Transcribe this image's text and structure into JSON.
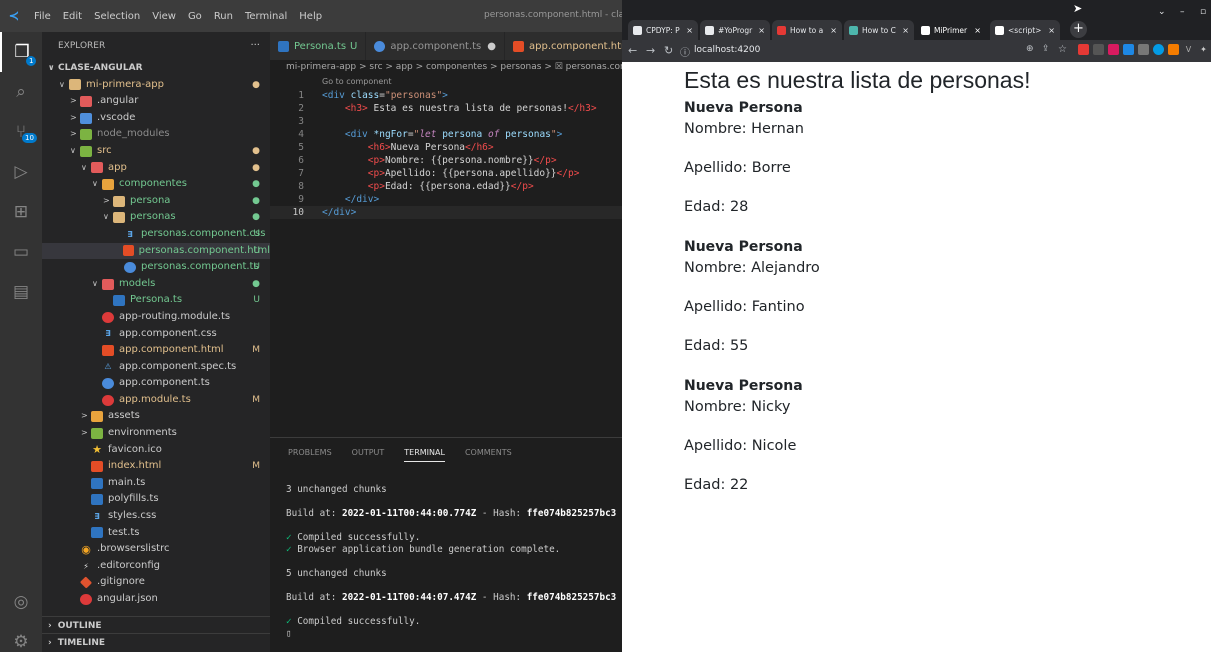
{
  "vscode": {
    "menu": [
      "File",
      "Edit",
      "Selection",
      "View",
      "Go",
      "Run",
      "Terminal",
      "Help"
    ],
    "window_title": "personas.component.html - clase-",
    "explorer_title": "EXPLORER",
    "explorer_more": "···",
    "tree": [
      {
        "label": "CLASE-ANGULAR",
        "arrow": "∨",
        "depth": 0,
        "icon": "",
        "status": "",
        "statusColor": "#ccc",
        "header": true,
        "color": "#cccccc"
      },
      {
        "label": "mi-primera-app",
        "arrow": "∨",
        "depth": 1,
        "icon": "folder",
        "status": "●",
        "statusColor": "#e2c08d",
        "color": "#e2c08d"
      },
      {
        "label": ".angular",
        "arrow": ">",
        "depth": 2,
        "icon": "folder-red",
        "status": "",
        "color": "#cccccc"
      },
      {
        "label": ".vscode",
        "arrow": ">",
        "depth": 2,
        "icon": "folder-blue",
        "status": "",
        "color": "#cccccc"
      },
      {
        "label": "node_modules",
        "arrow": ">",
        "depth": 2,
        "icon": "folder-green",
        "status": "",
        "color": "#8c8c8c"
      },
      {
        "label": "src",
        "arrow": "∨",
        "depth": 2,
        "icon": "folder-green",
        "status": "●",
        "statusColor": "#e2c08d",
        "color": "#e2c08d"
      },
      {
        "label": "app",
        "arrow": "∨",
        "depth": 3,
        "icon": "folder-red",
        "status": "●",
        "statusColor": "#e2c08d",
        "color": "#e2c08d"
      },
      {
        "label": "componentes",
        "arrow": "∨",
        "depth": 4,
        "icon": "folder-orange",
        "status": "●",
        "statusColor": "#73c991",
        "color": "#73c991"
      },
      {
        "label": "persona",
        "arrow": ">",
        "depth": 5,
        "icon": "folder",
        "status": "●",
        "statusColor": "#73c991",
        "color": "#73c991"
      },
      {
        "label": "personas",
        "arrow": "∨",
        "depth": 5,
        "icon": "folder",
        "status": "●",
        "statusColor": "#73c991",
        "color": "#73c991"
      },
      {
        "label": "personas.component.css",
        "arrow": "",
        "depth": 6,
        "icon": "css",
        "status": "U",
        "statusColor": "#73c991",
        "color": "#73c991"
      },
      {
        "label": "personas.component.html",
        "arrow": "",
        "depth": 6,
        "icon": "html",
        "status": "U",
        "statusColor": "#73c991",
        "color": "#73c991",
        "selected": true
      },
      {
        "label": "personas.component.ts",
        "arrow": "",
        "depth": 6,
        "icon": "ang-blue",
        "status": "U",
        "statusColor": "#73c991",
        "color": "#73c991"
      },
      {
        "label": "models",
        "arrow": "∨",
        "depth": 4,
        "icon": "folder-red",
        "status": "●",
        "statusColor": "#73c991",
        "color": "#73c991"
      },
      {
        "label": "Persona.ts",
        "arrow": "",
        "depth": 5,
        "icon": "ts",
        "status": "U",
        "statusColor": "#73c991",
        "color": "#73c991"
      },
      {
        "label": "app-routing.module.ts",
        "arrow": "",
        "depth": 4,
        "icon": "ang",
        "status": "",
        "color": "#cccccc"
      },
      {
        "label": "app.component.css",
        "arrow": "",
        "depth": 4,
        "icon": "css",
        "status": "",
        "color": "#cccccc"
      },
      {
        "label": "app.component.html",
        "arrow": "",
        "depth": 4,
        "icon": "html",
        "status": "M",
        "statusColor": "#e2c08d",
        "color": "#e2c08d"
      },
      {
        "label": "app.component.spec.ts",
        "arrow": "",
        "depth": 4,
        "icon": "spec",
        "status": "",
        "color": "#cccccc"
      },
      {
        "label": "app.component.ts",
        "arrow": "",
        "depth": 4,
        "icon": "ang-blue",
        "status": "",
        "color": "#cccccc"
      },
      {
        "label": "app.module.ts",
        "arrow": "",
        "depth": 4,
        "icon": "ang",
        "status": "M",
        "statusColor": "#e2c08d",
        "color": "#e2c08d"
      },
      {
        "label": "assets",
        "arrow": ">",
        "depth": 3,
        "icon": "folder-orange",
        "status": "",
        "color": "#cccccc"
      },
      {
        "label": "environments",
        "arrow": ">",
        "depth": 3,
        "icon": "folder-green",
        "status": "",
        "color": "#cccccc"
      },
      {
        "label": "favicon.ico",
        "arrow": "",
        "depth": 3,
        "icon": "star",
        "status": "",
        "color": "#cccccc"
      },
      {
        "label": "index.html",
        "arrow": "",
        "depth": 3,
        "icon": "html",
        "status": "M",
        "statusColor": "#e2c08d",
        "color": "#e2c08d"
      },
      {
        "label": "main.ts",
        "arrow": "",
        "depth": 3,
        "icon": "ts",
        "status": "",
        "color": "#cccccc"
      },
      {
        "label": "polyfills.ts",
        "arrow": "",
        "depth": 3,
        "icon": "ts",
        "status": "",
        "color": "#cccccc"
      },
      {
        "label": "styles.css",
        "arrow": "",
        "depth": 3,
        "icon": "css",
        "status": "",
        "color": "#cccccc"
      },
      {
        "label": "test.ts",
        "arrow": "",
        "depth": 3,
        "icon": "ts",
        "status": "",
        "color": "#cccccc"
      },
      {
        "label": ".browserslistrc",
        "arrow": "",
        "depth": 2,
        "icon": "brow",
        "status": "",
        "color": "#cccccc"
      },
      {
        "label": ".editorconfig",
        "arrow": "",
        "depth": 2,
        "icon": "ec",
        "status": "",
        "color": "#cccccc"
      },
      {
        "label": ".gitignore",
        "arrow": "",
        "depth": 2,
        "icon": "git",
        "status": "",
        "color": "#cccccc"
      },
      {
        "label": "angular.json",
        "arrow": "",
        "depth": 2,
        "icon": "ang",
        "status": "",
        "color": "#cccccc"
      }
    ],
    "outline_label": "OUTLINE",
    "timeline_label": "TIMELINE",
    "source_control_badge": "10",
    "account_badge": "1",
    "tabs": [
      {
        "label": "Persona.ts",
        "suffix": "U",
        "icon": "ts",
        "active": false
      },
      {
        "label": "app.component.ts",
        "suffix": "●",
        "icon": "ang-blue",
        "active": false
      },
      {
        "label": "app.component.html",
        "suffix": "M",
        "icon": "html",
        "active": false
      }
    ],
    "breadcrumb": "mi-primera-app > src > app > componentes > personas > ☒ personas.comp",
    "goto_component": "Go to component",
    "code_lines": [
      {
        "n": "1",
        "html": "<span class='t'>&lt;div</span> <span class='a'>class</span><span class='w'>=</span><span class='s'>\"personas\"</span><span class='t'>&gt;</span>"
      },
      {
        "n": "2",
        "html": "    <span class='h'>&lt;h3&gt;</span><span class='w'> Esta es nuestra lista de personas!</span><span class='h'>&lt;/h3&gt;</span>"
      },
      {
        "n": "3",
        "html": ""
      },
      {
        "n": "4",
        "html": "    <span class='t'>&lt;div</span> <span class='a'>*ngFor</span><span class='w'>=</span><span class='s'>\"</span><span class='k'>let</span><span class='a'> persona </span><span class='k'>of</span><span class='a'> personas</span><span class='s'>\"</span><span class='t'>&gt;</span>"
      },
      {
        "n": "5",
        "html": "        <span class='h'>&lt;h6&gt;</span><span class='w'>Nueva Persona</span><span class='h'>&lt;/h6&gt;</span>"
      },
      {
        "n": "6",
        "html": "        <span class='h'>&lt;p&gt;</span><span class='w'>Nombre: {{persona.nombre}}</span><span class='h'>&lt;/p&gt;</span>"
      },
      {
        "n": "7",
        "html": "        <span class='h'>&lt;p&gt;</span><span class='w'>Apellido: {{persona.apellido}}</span><span class='h'>&lt;/p&gt;</span>"
      },
      {
        "n": "8",
        "html": "        <span class='h'>&lt;p&gt;</span><span class='w'>Edad: {{persona.edad}}</span><span class='h'>&lt;/p&gt;</span>"
      },
      {
        "n": "9",
        "html": "    <span class='t'>&lt;/div&gt;</span>"
      },
      {
        "n": "10",
        "html": "<span class='t'>&lt;/div&gt;</span>",
        "current": true
      }
    ],
    "panel_tabs": [
      "PROBLEMS",
      "OUTPUT",
      "TERMINAL",
      "COMMENTS"
    ],
    "panel_active": "TERMINAL",
    "terminal": [
      {
        "kind": "plain",
        "text": "3 unchanged chunks"
      },
      {
        "kind": "blank",
        "text": ""
      },
      {
        "kind": "build",
        "prefix": "Build at: ",
        "date": "2022-01-11T00:44:00.774Z",
        "mid": " - Hash: ",
        "hash": "ffe074b825257bc3"
      },
      {
        "kind": "blank",
        "text": ""
      },
      {
        "kind": "ok",
        "text": "Compiled successfully."
      },
      {
        "kind": "ok",
        "text": "Browser application bundle generation complete."
      },
      {
        "kind": "blank",
        "text": ""
      },
      {
        "kind": "plain",
        "text": "5 unchanged chunks"
      },
      {
        "kind": "blank",
        "text": ""
      },
      {
        "kind": "build",
        "prefix": "Build at: ",
        "date": "2022-01-11T00:44:07.474Z",
        "mid": " - Hash: ",
        "hash": "ffe074b825257bc3"
      },
      {
        "kind": "blank",
        "text": ""
      },
      {
        "kind": "ok",
        "text": "Compiled successfully."
      },
      {
        "kind": "cursor",
        "text": "▯"
      }
    ]
  },
  "browser": {
    "tabs": [
      {
        "label": "CPDYP: P",
        "color": "#e8eaed"
      },
      {
        "label": "#YoProgr",
        "color": "#e8eaed"
      },
      {
        "label": "How to a",
        "color": "#e53935"
      },
      {
        "label": "How to C",
        "color": "#4db6ac"
      },
      {
        "label": "MiPrimer",
        "color": "#ffffff",
        "active": true
      },
      {
        "label": "<script>",
        "color": "#ffffff"
      }
    ],
    "tab_close": "×",
    "new_tab": "+",
    "url": "localhost:4200",
    "page": {
      "heading": "Esta es nuestra lista de personas!",
      "personas": [
        {
          "title": "Nueva Persona",
          "nombre": "Nombre: Hernan",
          "apellido": "Apellido: Borre",
          "edad": "Edad: 28"
        },
        {
          "title": "Nueva Persona",
          "nombre": "Nombre: Alejandro",
          "apellido": "Apellido: Fantino",
          "edad": "Edad: 55"
        },
        {
          "title": "Nueva Persona",
          "nombre": "Nombre: Nicky",
          "apellido": "Apellido: Nicole",
          "edad": "Edad: 22"
        }
      ]
    }
  }
}
